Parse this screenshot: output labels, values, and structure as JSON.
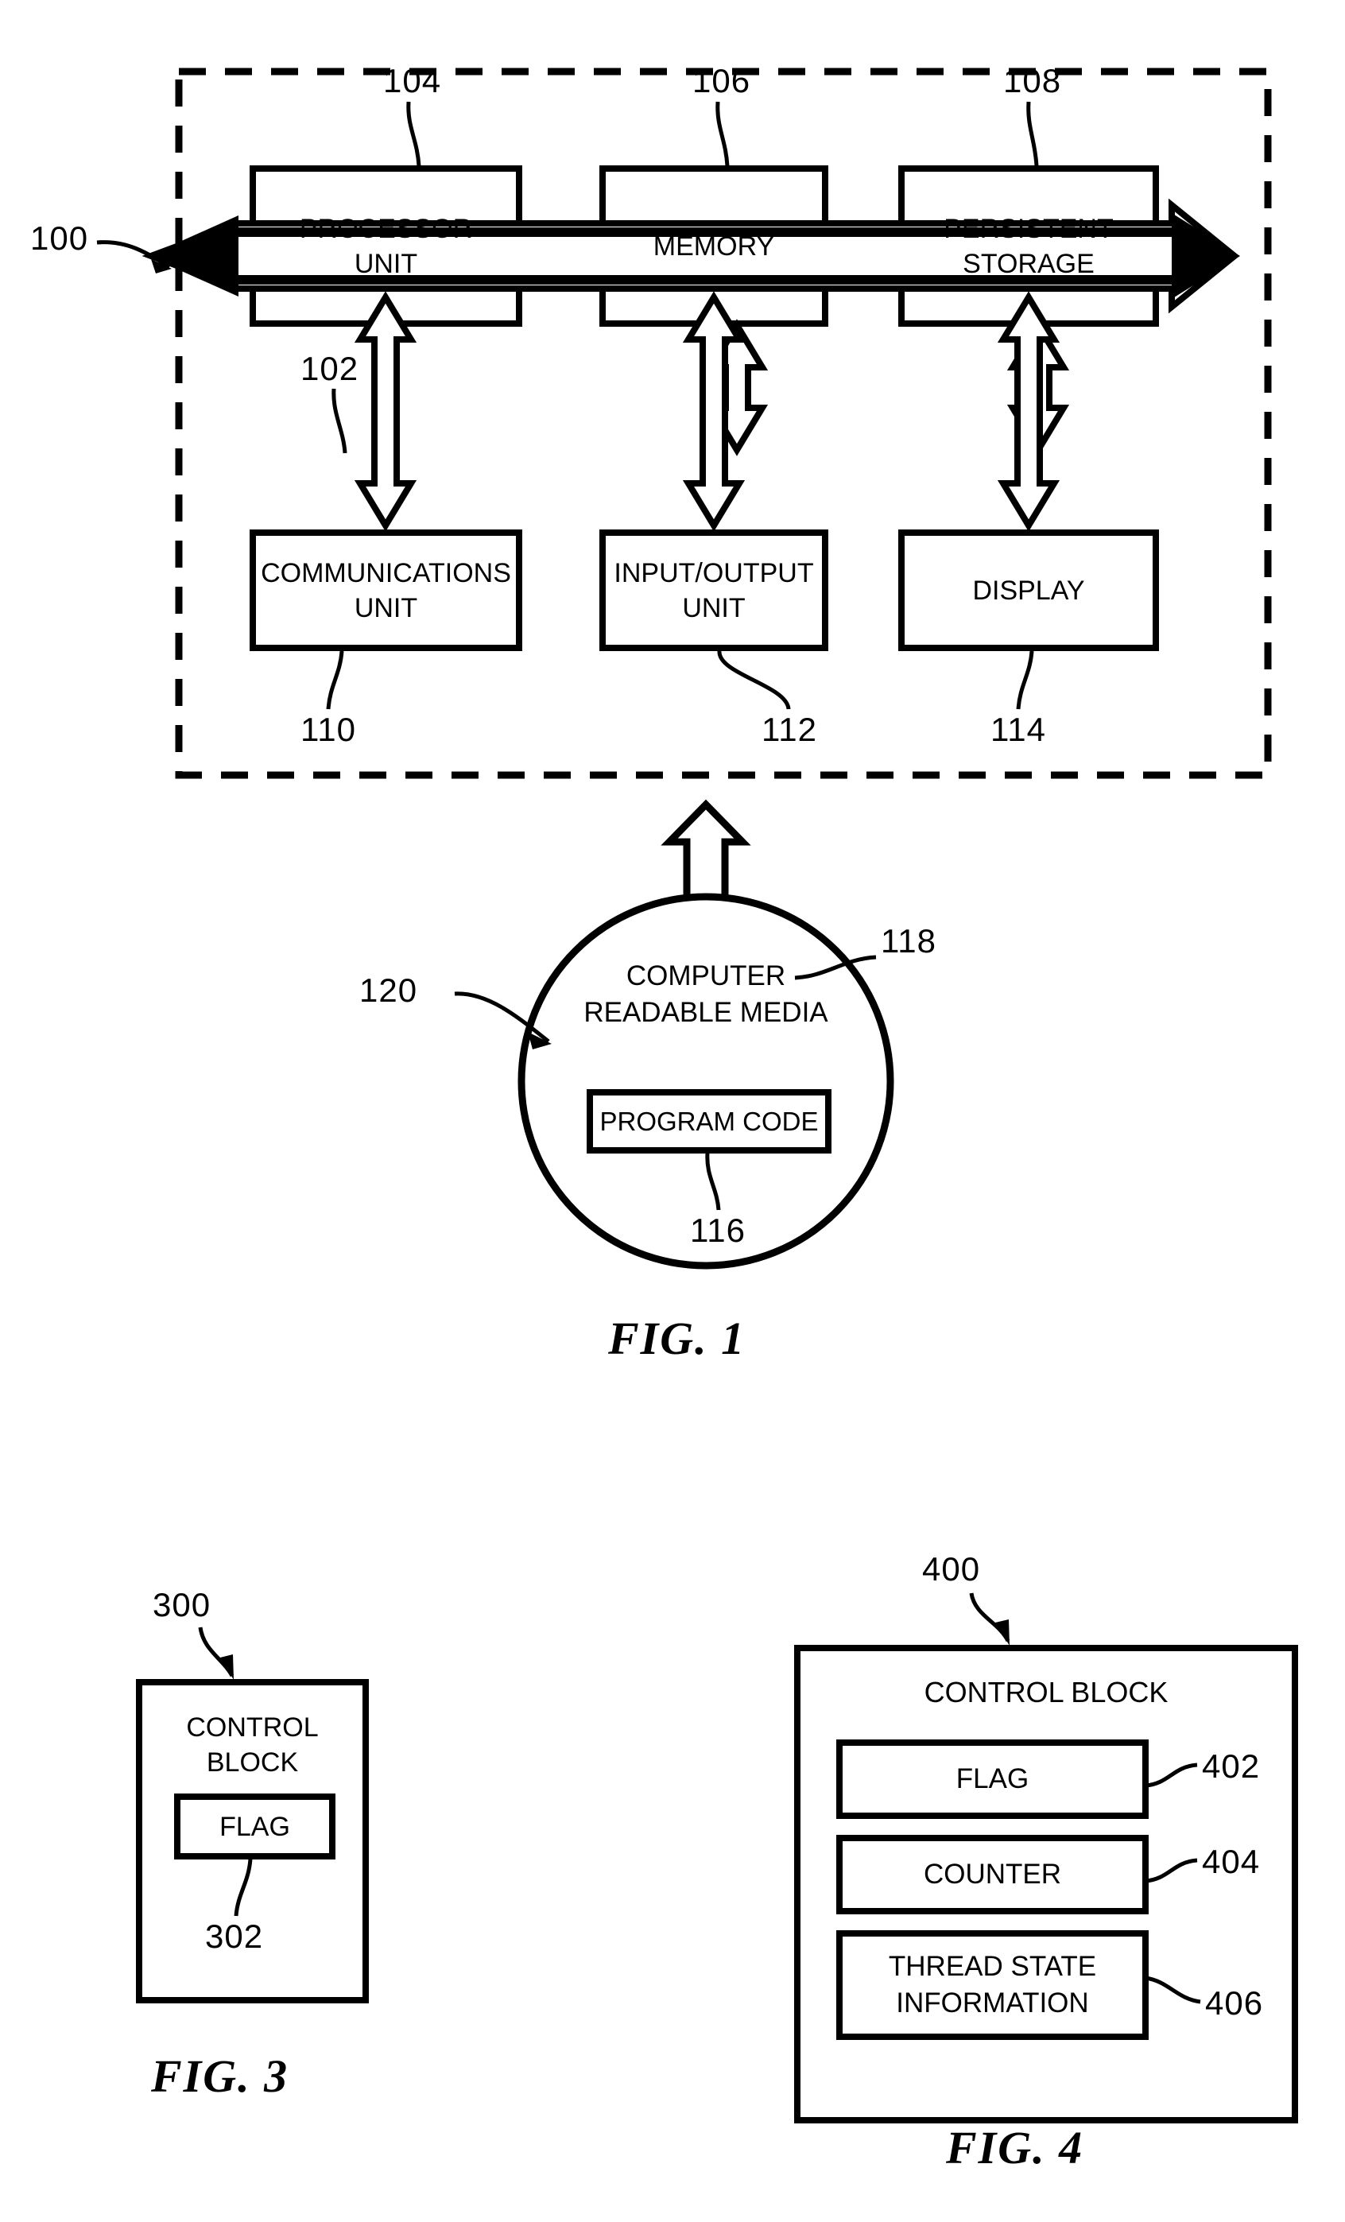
{
  "document": {
    "type": "patent-drawing-sheet",
    "figure_count": 3
  },
  "figure1": {
    "caption": "FIG. 1",
    "system_ref": "100",
    "bus_ref": "102",
    "boxes": [
      {
        "id": "processor-unit",
        "label_line1": "PROCESSOR",
        "label_line2": "UNIT",
        "ref": "104"
      },
      {
        "id": "memory",
        "label_line1": "MEMORY",
        "label_line2": "",
        "ref": "106"
      },
      {
        "id": "persistent-storage",
        "label_line1": "PERSISTENT",
        "label_line2": "STORAGE",
        "ref": "108"
      },
      {
        "id": "communications-unit",
        "label_line1": "COMMUNICATIONS",
        "label_line2": "UNIT",
        "ref": "110"
      },
      {
        "id": "input-output-unit",
        "label_line1": "INPUT/OUTPUT",
        "label_line2": "UNIT",
        "ref": "112"
      },
      {
        "id": "display",
        "label_line1": "DISPLAY",
        "label_line2": "",
        "ref": "114"
      }
    ],
    "media": {
      "label_line1": "COMPUTER",
      "label_line2": "READABLE MEDIA",
      "media_ref": "118",
      "product_ref": "120",
      "program_code_label": "PROGRAM CODE",
      "program_code_ref": "116"
    }
  },
  "figure3": {
    "caption": "FIG. 3",
    "block_ref": "300",
    "title_line1": "CONTROL",
    "title_line2": "BLOCK",
    "fields": [
      {
        "label": "FLAG",
        "ref": "302"
      }
    ]
  },
  "figure4": {
    "caption": "FIG. 4",
    "block_ref": "400",
    "title": "CONTROL BLOCK",
    "fields": [
      {
        "label": "FLAG",
        "ref": "402"
      },
      {
        "label": "COUNTER",
        "ref": "404"
      },
      {
        "label_line1": "THREAD STATE",
        "label_line2": "INFORMATION",
        "ref": "406"
      }
    ]
  },
  "style": {
    "ink": "#000000",
    "paper": "#ffffff"
  }
}
